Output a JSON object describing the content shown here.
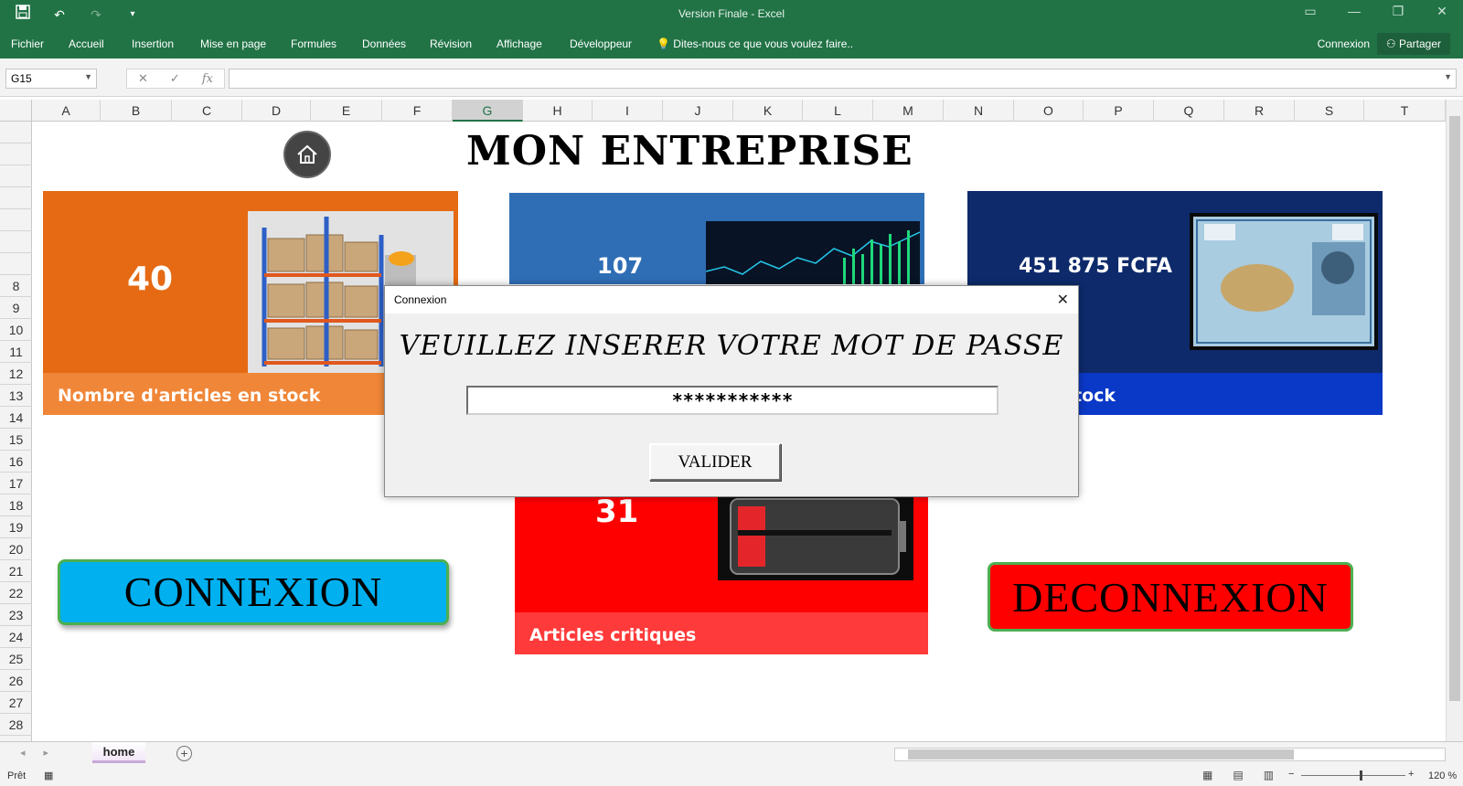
{
  "window": {
    "title": "Version Finale - Excel"
  },
  "quick_access": {
    "save_icon": "save-icon",
    "undo_icon": "undo-icon",
    "redo_icon": "redo-icon",
    "customize_icon": "customize-icon"
  },
  "ribbon": {
    "tabs": [
      "Fichier",
      "Accueil",
      "Insertion",
      "Mise en page",
      "Formules",
      "Données",
      "Révision",
      "Affichage",
      "Développeur"
    ],
    "tell_me": "Dites-nous ce que vous voulez faire..",
    "login": "Connexion",
    "share": "Partager"
  },
  "formula_bar": {
    "name_box": "G15",
    "fx": "fx",
    "content": ""
  },
  "grid": {
    "columns": [
      "A",
      "B",
      "C",
      "D",
      "E",
      "F",
      "G",
      "H",
      "I",
      "J",
      "K",
      "L",
      "M",
      "N",
      "O",
      "P",
      "Q",
      "R",
      "S",
      "T"
    ],
    "selected_column": "G",
    "rows": [
      "",
      "",
      "",
      "",
      "",
      "",
      "",
      "8",
      "9",
      "10",
      "11",
      "12",
      "13",
      "14",
      "15",
      "16",
      "17",
      "18",
      "19",
      "20",
      "21",
      "22",
      "23",
      "24",
      "25",
      "26",
      "27",
      "28"
    ]
  },
  "dashboard": {
    "title": "MON ENTREPRISE",
    "cards": [
      {
        "value": "40",
        "label": "Nombre d'articles en stock"
      },
      {
        "value": "107",
        "label": ""
      },
      {
        "value": "451 875 FCFA",
        "label": "tock"
      },
      {
        "value": "31",
        "label": "Articles critiques"
      }
    ],
    "connexion_button": "CONNEXION",
    "deconnexion_button": "DECONNEXION",
    "colors": {
      "orange": "#e56a13",
      "blue": "#2f6eb5",
      "navy": "#0e2a6b",
      "red": "#ff0000",
      "connexion": "#00b0ef"
    }
  },
  "dialog": {
    "title": "Connexion",
    "prompt": "VEUILLEZ INSERER VOTRE MOT DE PASSE",
    "password_value": "***********",
    "submit": "VALIDER",
    "close_icon": "close-icon"
  },
  "sheets": {
    "tabs": [
      "home"
    ],
    "active": "home"
  },
  "status": {
    "ready": "Prêt",
    "zoom": "120 %"
  }
}
